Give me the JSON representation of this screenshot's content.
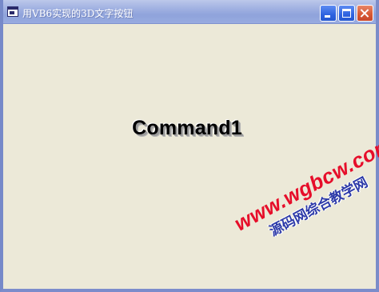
{
  "window": {
    "title": "用VB6实现的3D文字按钮"
  },
  "form": {
    "command_button_label": "Command1"
  },
  "watermark": {
    "url": "www.wgbcw.com",
    "subtitle": "源码网综合教学网"
  },
  "colors": {
    "titlebar": "#a2b2e2",
    "window_bg": "#ece9d8",
    "close_button": "#d85a34",
    "control_button": "#2d62e0",
    "watermark_url": "#e60e2a",
    "watermark_sub": "#2c39a8"
  },
  "icons": {
    "app": "app-window-icon",
    "minimize": "minimize-icon",
    "maximize": "maximize-icon",
    "close": "close-icon"
  }
}
